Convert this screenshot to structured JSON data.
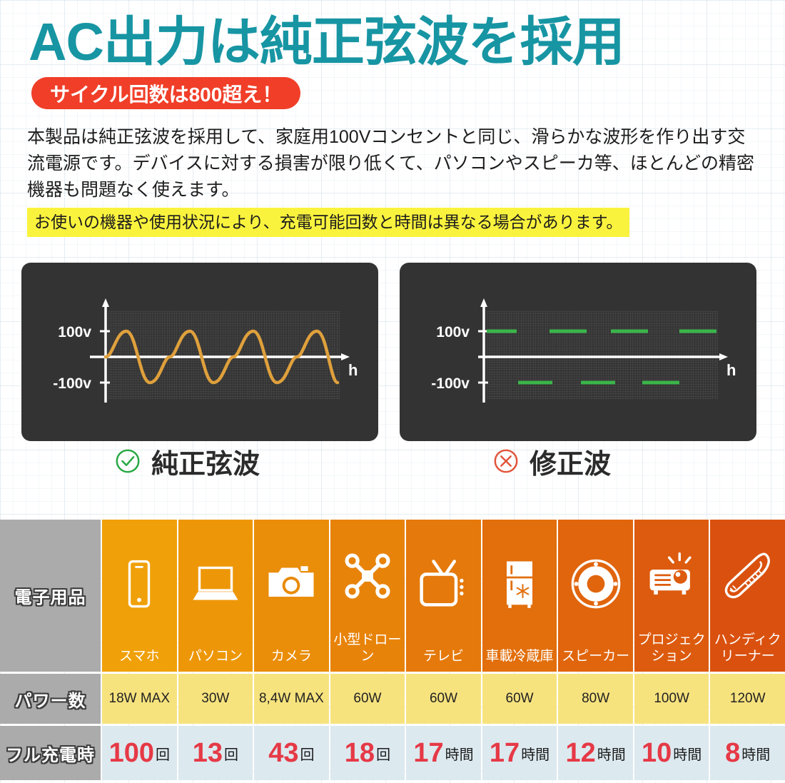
{
  "header": {
    "title": "AC出力は純正弦波を採用",
    "badge": "サイクル回数は800超え！",
    "title_color": "#1795A3",
    "badge_color": "#F03E28"
  },
  "body": {
    "paragraph": "本製品は純正弦波を採用して、家庭用100Vコンセントと同じ、滑らかな波形を作り出す交流電源です。デバイスに対する損害が限り低くて、パソコンやスピーカ等、ほとんどの精密機器も問題なく使えます。",
    "note": "お使いの機器や使用状況により、充電可能回数と時間は異なる場合があります。",
    "note_bg": "#FAF33E"
  },
  "waveforms": [
    {
      "caption": "純正弦波",
      "mark": "check-circle-icon",
      "mark_color": "#27A844",
      "wave_color": "#DFA03C",
      "type": "sine",
      "y_labels": [
        "100v",
        "-100v"
      ],
      "x_label": "h",
      "panel_bg": "#333333"
    },
    {
      "caption": "修正波",
      "mark": "cross-circle-icon",
      "mark_color": "#E2543B",
      "wave_color": "#3BB54A",
      "type": "modified-square",
      "y_labels": [
        "100v",
        "-100v"
      ],
      "x_label": "h",
      "panel_bg": "#333333"
    }
  ],
  "table": {
    "row_labels": [
      "電子用品",
      "パワー数",
      "フル充電時"
    ],
    "label_bg": "#ABABAB",
    "power_bg": "#F7E37E",
    "charge_bg": "#DCE9EF",
    "number_color": "#E63946",
    "columns": [
      {
        "name": "スマホ",
        "icon": "smartphone-icon",
        "power": "18W MAX",
        "value": "100",
        "unit": "回",
        "bg": "#F0A008"
      },
      {
        "name": "パソコン",
        "icon": "laptop-icon",
        "power": "30W",
        "value": "13",
        "unit": "回",
        "bg": "#ED9708"
      },
      {
        "name": "カメラ",
        "icon": "camera-icon",
        "power": "8,4W MAX",
        "value": "43",
        "unit": "回",
        "bg": "#EA8D09"
      },
      {
        "name": "小型ドローン",
        "icon": "drone-icon",
        "power": "60W",
        "value": "18",
        "unit": "回",
        "bg": "#E8830A"
      },
      {
        "name": "テレビ",
        "icon": "tv-icon",
        "power": "60W",
        "value": "17",
        "unit": "時間",
        "bg": "#E5790B"
      },
      {
        "name": "車載冷蔵庫",
        "icon": "fridge-icon",
        "power": "60W",
        "value": "17",
        "unit": "時間",
        "bg": "#E26F0C"
      },
      {
        "name": "スピーカー",
        "icon": "speaker-icon",
        "power": "80W",
        "value": "12",
        "unit": "時間",
        "bg": "#E0650D"
      },
      {
        "name": "プロジェク\nション",
        "icon": "projector-icon",
        "power": "100W",
        "value": "10",
        "unit": "時間",
        "bg": "#DD5B0E"
      },
      {
        "name": "ハンディク\nリーナー",
        "icon": "vacuum-icon",
        "power": "120W",
        "value": "8",
        "unit": "時間",
        "bg": "#DA510F"
      }
    ]
  }
}
